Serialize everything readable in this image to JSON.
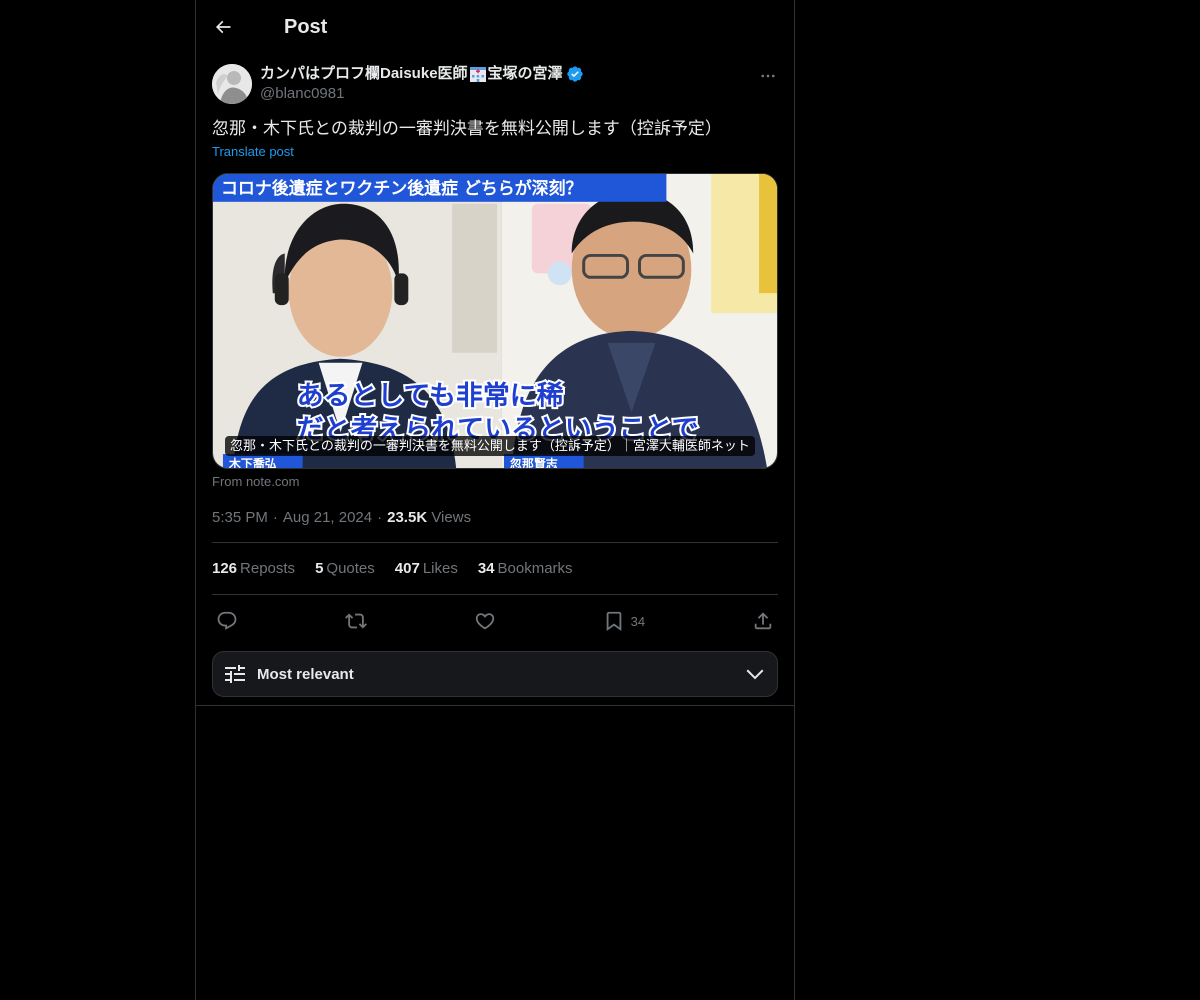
{
  "header": {
    "title": "Post"
  },
  "author": {
    "display_name_prefix": "カンパはプロフ欄Daisuke医師",
    "display_name_suffix": "宝塚の宮澤",
    "handle": "@blanc0981",
    "verified": true
  },
  "post": {
    "text": "忽那・木下氏との裁判の一審判決書を無料公開します（控訴予定）",
    "translate_label": "Translate post"
  },
  "card": {
    "caption": "忽那・木下氏との裁判の一審判決書を無料公開します（控訴予定）｜宮澤大輔医師ネット",
    "source": "From note.com",
    "image_top_banner": "コロナ後遺症とワクチン後遺症 どちらが深刻？",
    "image_subtitle_line1": "あるとしても非常に稀",
    "image_subtitle_line2": "だと考えられているということで",
    "image_name_left": "木下喬弘",
    "image_name_right": "忽那賢志"
  },
  "meta": {
    "time": "5:35 PM",
    "date": "Aug 21, 2024",
    "views_count": "23.5K",
    "views_label": "Views"
  },
  "stats": {
    "reposts_count": "126",
    "reposts_label": "Reposts",
    "quotes_count": "5",
    "quotes_label": "Quotes",
    "likes_count": "407",
    "likes_label": "Likes",
    "bookmarks_count": "34",
    "bookmarks_label": "Bookmarks"
  },
  "actions": {
    "bookmark_count": "34"
  },
  "sort": {
    "label": "Most relevant"
  },
  "colors": {
    "accent": "#1d9bf0",
    "background": "#000000",
    "border": "#2f3336",
    "muted": "#71767b",
    "text": "#e7e9ea"
  },
  "icons": [
    "back-arrow-icon",
    "hospital-icon",
    "verified-badge-icon",
    "more-icon",
    "reply-icon",
    "repost-icon",
    "like-icon",
    "bookmark-icon",
    "share-icon",
    "sliders-icon",
    "chevron-down-icon"
  ]
}
